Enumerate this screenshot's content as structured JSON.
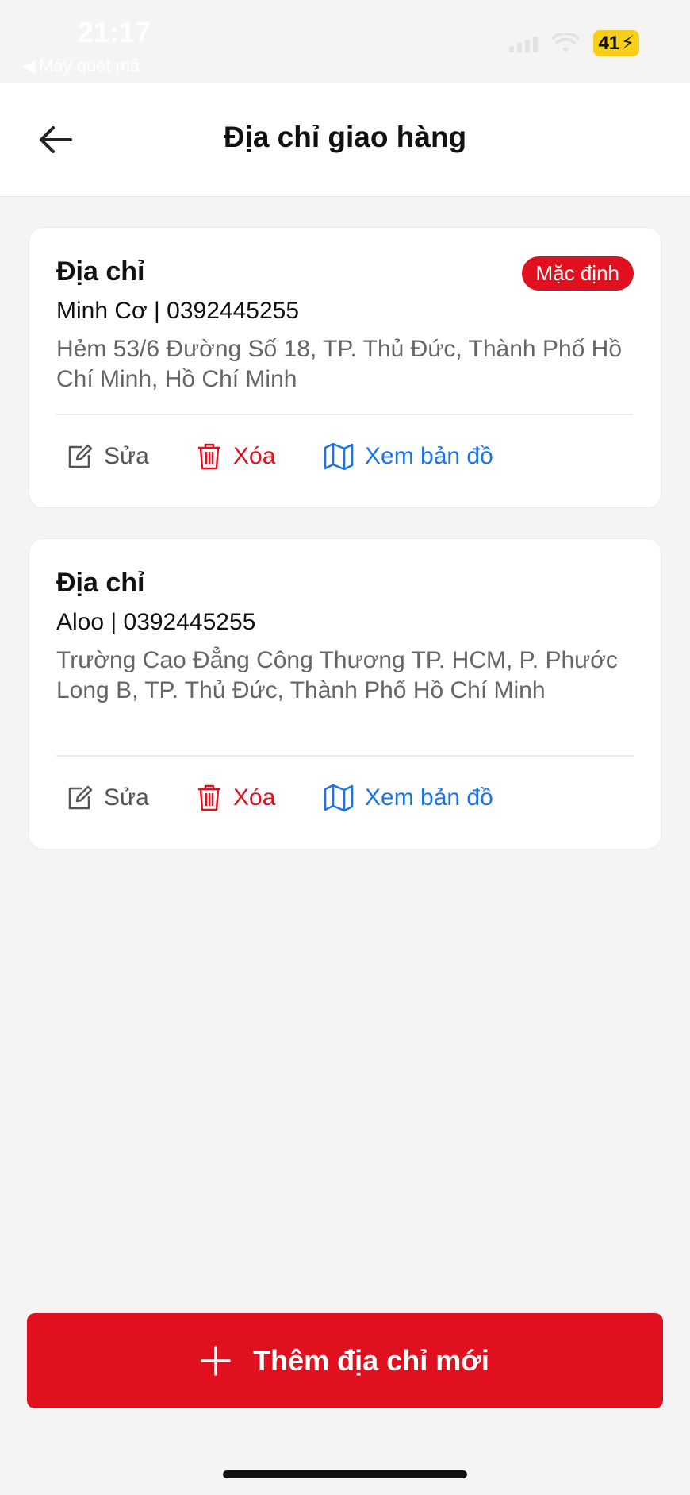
{
  "status_bar": {
    "time": "21:17",
    "back_app": "Máy quét mã",
    "battery": "41"
  },
  "header": {
    "title": "Địa chỉ giao hàng"
  },
  "addresses": [
    {
      "title": "Địa chỉ",
      "badge": "Mặc định",
      "contact": "Minh Cơ | 0392445255",
      "address": "Hẻm 53/6 Đường Số 18, TP. Thủ Đức, Thành Phố Hồ Chí Minh, Hồ Chí Minh"
    },
    {
      "title": "Địa chỉ",
      "contact": "Aloo | 0392445255",
      "address": "Trường Cao Đẳng Công Thương TP. HCM, P. Phước Long B, TP. Thủ Đức, Thành Phố Hồ Chí Minh"
    }
  ],
  "actions": {
    "edit": "Sửa",
    "delete": "Xóa",
    "map": "Xem bản đồ"
  },
  "add_button": {
    "label": "Thêm địa chỉ mới"
  },
  "colors": {
    "primary": "#e0101e",
    "link": "#1a73e8",
    "background": "#f4f4f4"
  }
}
